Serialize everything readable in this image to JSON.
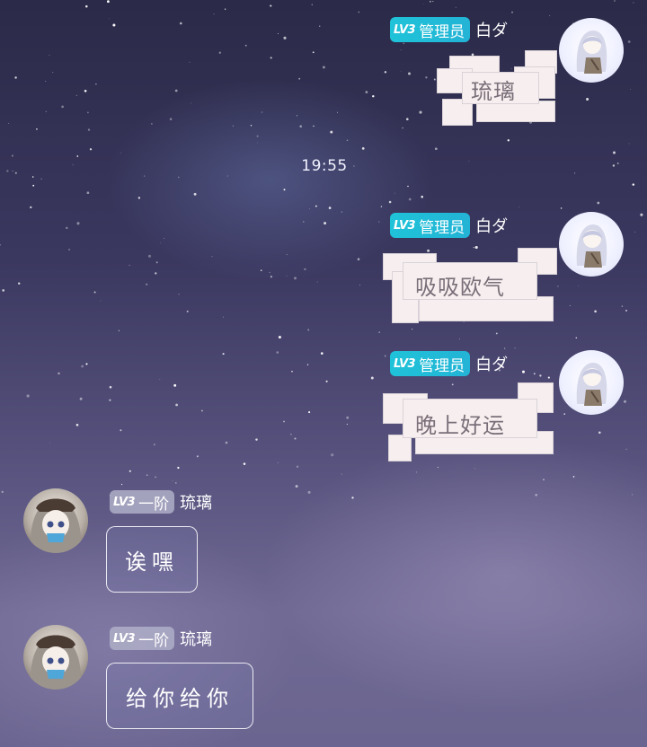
{
  "timestamp": "19:55",
  "messages": [
    {
      "side": "right",
      "badge_level": "LV3",
      "badge_title": "管理员",
      "user": "白ダ",
      "text": "琉璃"
    },
    {
      "side": "right",
      "badge_level": "LV3",
      "badge_title": "管理员",
      "user": "白ダ",
      "text": "吸吸欧气"
    },
    {
      "side": "right",
      "badge_level": "LV3",
      "badge_title": "管理员",
      "user": "白ダ",
      "text": "晚上好运"
    },
    {
      "side": "left",
      "badge_level": "LV3",
      "badge_title": "一阶",
      "user": "琉璃",
      "text": "诶嘿"
    },
    {
      "side": "left",
      "badge_level": "LV3",
      "badge_title": "一阶",
      "user": "琉璃",
      "text": "给你给你"
    }
  ],
  "colors": {
    "admin_badge": "#1fc3d8",
    "level_badge": "#afafc8",
    "block_bubble": "#f7efef",
    "block_text": "#7a6f79"
  }
}
